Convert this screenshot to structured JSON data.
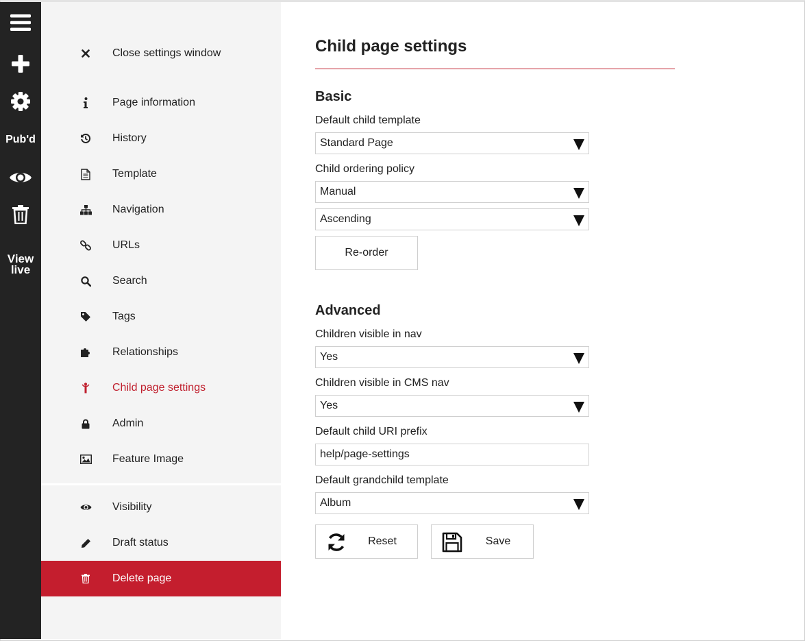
{
  "rail": {
    "published_label": "Pub'd",
    "view_live_line1": "View",
    "view_live_line2": "live",
    "icons": [
      "menu-icon",
      "plus-icon",
      "gear-icon",
      "eye-icon",
      "trash-icon"
    ]
  },
  "sidebar": {
    "items": [
      {
        "label": "Close settings window",
        "icon": "close-icon"
      },
      {
        "label": "Page information",
        "icon": "info-icon"
      },
      {
        "label": "History",
        "icon": "history-icon"
      },
      {
        "label": "Template",
        "icon": "document-icon"
      },
      {
        "label": "Navigation",
        "icon": "sitemap-icon"
      },
      {
        "label": "URLs",
        "icon": "link-icon"
      },
      {
        "label": "Search",
        "icon": "search-icon"
      },
      {
        "label": "Tags",
        "icon": "tag-icon"
      },
      {
        "label": "Relationships",
        "icon": "puzzle-icon"
      },
      {
        "label": "Child page settings",
        "icon": "child-icon"
      },
      {
        "label": "Admin",
        "icon": "lock-icon"
      },
      {
        "label": "Feature Image",
        "icon": "image-icon"
      },
      {
        "label": "Visibility",
        "icon": "eye-icon"
      },
      {
        "label": "Draft status",
        "icon": "pencil-icon"
      },
      {
        "label": "Delete page",
        "icon": "trash-icon"
      }
    ],
    "active_item": "Child page settings"
  },
  "main": {
    "title": "Child page settings",
    "basic": {
      "heading": "Basic",
      "default_child_template_label": "Default child template",
      "default_child_template_value": "Standard Page",
      "child_ordering_policy_label": "Child ordering policy",
      "child_ordering_policy_value": "Manual",
      "child_ordering_direction_value": "Ascending",
      "reorder_button": "Re-order"
    },
    "advanced": {
      "heading": "Advanced",
      "children_visible_nav_label": "Children visible in nav",
      "children_visible_nav_value": "Yes",
      "children_visible_cms_nav_label": "Children visible in CMS nav",
      "children_visible_cms_nav_value": "Yes",
      "default_child_uri_prefix_label": "Default child URI prefix",
      "default_child_uri_prefix_value": "help/page-settings",
      "default_grandchild_template_label": "Default grandchild template",
      "default_grandchild_template_value": "Album"
    },
    "reset_button": "Reset",
    "save_button": "Save"
  },
  "colors": {
    "accent": "#c0202e",
    "danger_bg": "#c41e2e",
    "rail_bg": "#232323",
    "sidebar_bg": "#f4f4f4"
  }
}
